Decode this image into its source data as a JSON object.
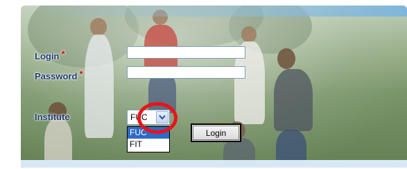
{
  "form": {
    "login_label": "Login",
    "login_required": "*",
    "login_value": "",
    "password_label": "Password",
    "password_required": "*",
    "password_value": "",
    "institute_label": "Institute",
    "institute_selected": "FUC",
    "institute_options": [
      "FUC",
      "FIT"
    ],
    "institute_highlighted_option": "FUC",
    "login_button": "Login"
  },
  "icons": {
    "dropdown_arrow": "chevron-down-icon"
  },
  "colors": {
    "label_text": "#1f3c73",
    "required_marker": "#c01515",
    "accent_blue": "#7fb6db",
    "selection_blue": "#316ac5",
    "annotation_ring": "#e8141b"
  }
}
